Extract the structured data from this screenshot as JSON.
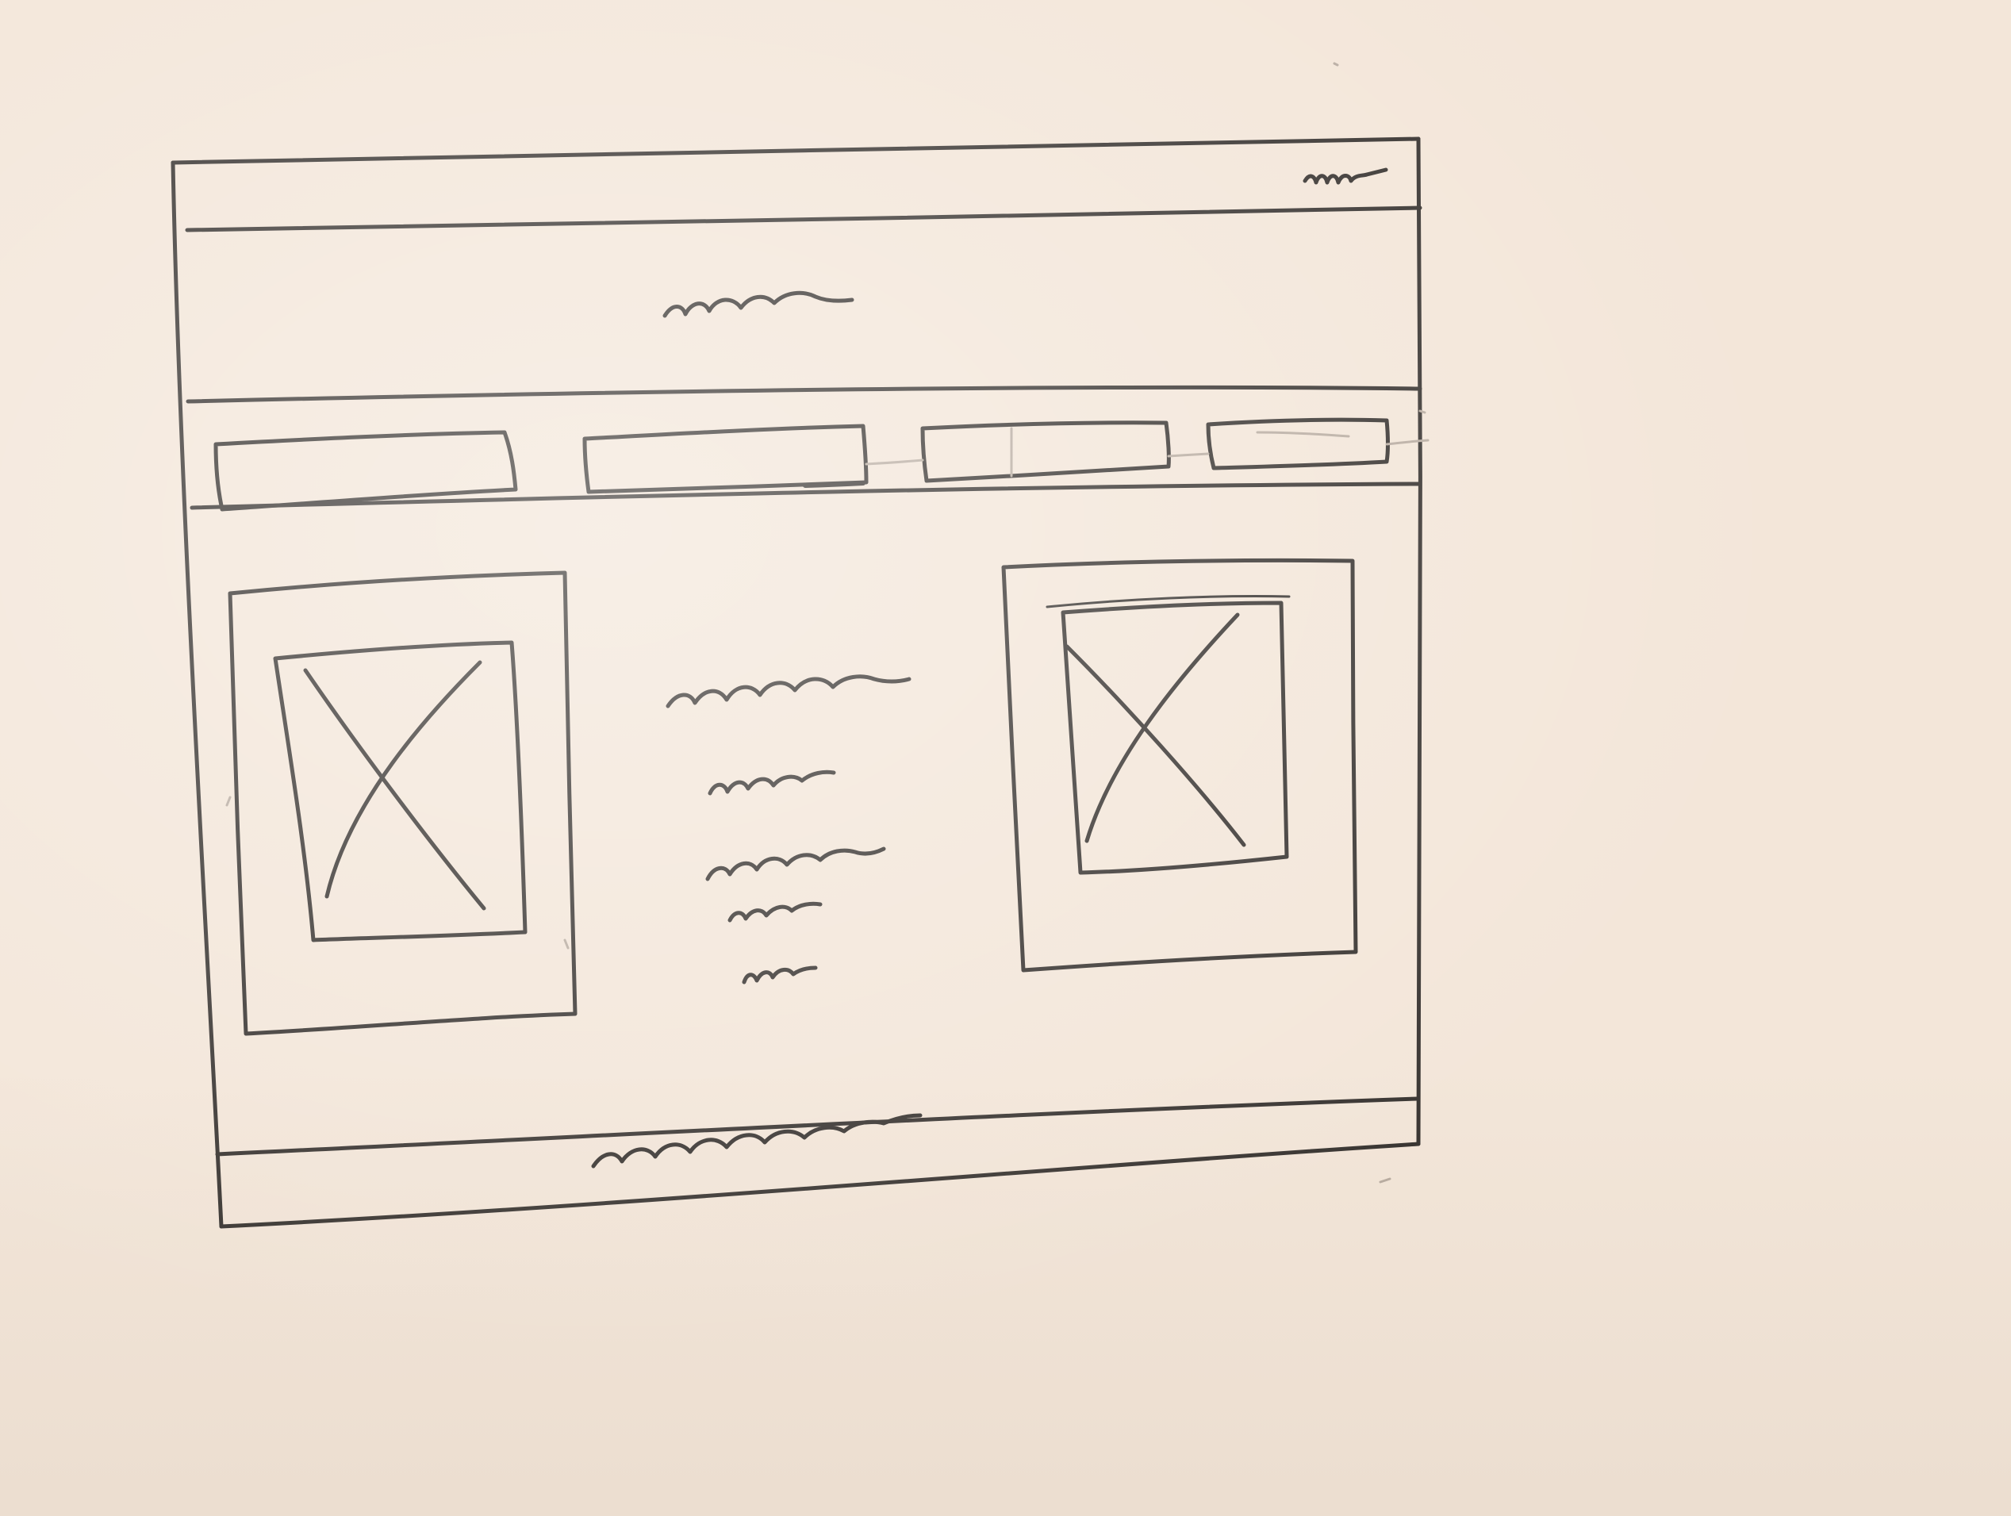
{
  "sketch": {
    "medium": "pencil on paper",
    "colors": {
      "paper": "#f3e6d9",
      "pencil": "#3a3633",
      "faint_pencil": "#b9ada2"
    },
    "header": {
      "right_placeholder": "squiggle"
    },
    "banner": {
      "title_placeholder": "squiggle"
    },
    "nav": {
      "tab_count": 4
    },
    "content": {
      "left_image_placeholder": "x-box-icon",
      "right_image_placeholder": "x-box-icon",
      "text_lines_count": 5
    },
    "footer": {
      "text_placeholder": "squiggle"
    }
  }
}
